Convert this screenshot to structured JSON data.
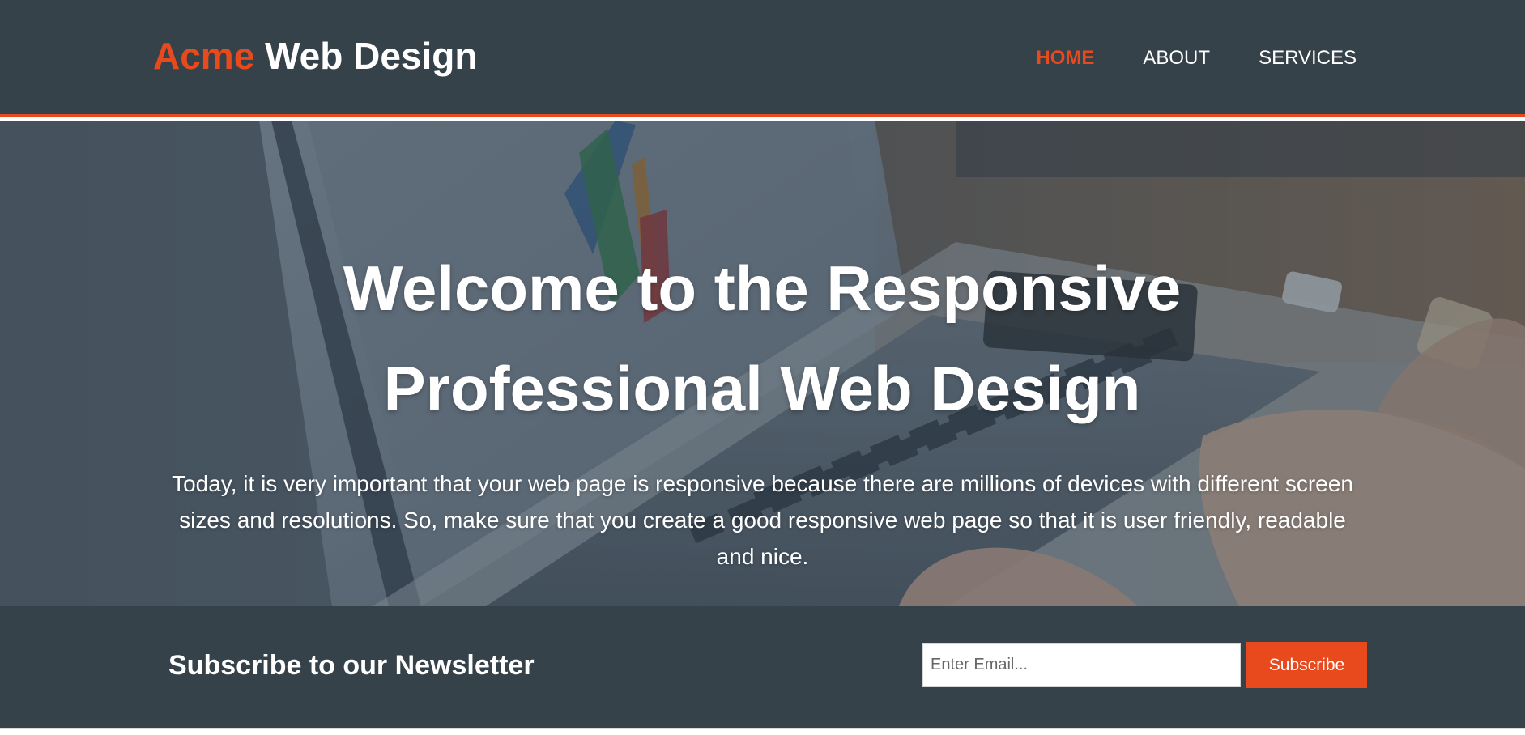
{
  "colors": {
    "header_bg": "#35424a",
    "accent": "#e8491d",
    "text_light": "#ffffff"
  },
  "header": {
    "logo_accent": "Acme",
    "logo_rest": " Web Design",
    "nav": [
      {
        "label": "HOME",
        "active": true
      },
      {
        "label": "ABOUT",
        "active": false
      },
      {
        "label": "SERVICES",
        "active": false
      }
    ]
  },
  "hero": {
    "title": "Welcome to the Responsive Professional Web Design",
    "text": "Today, it is very important that your web page is responsive because there are millions of devices with different screen sizes and resolutions. So, make sure that you create a good responsive web page so that it is user friendly, readable and nice."
  },
  "newsletter": {
    "heading": "Subscribe to our Newsletter",
    "email_placeholder": "Enter Email...",
    "email_value": "",
    "button_label": "Subscribe"
  }
}
